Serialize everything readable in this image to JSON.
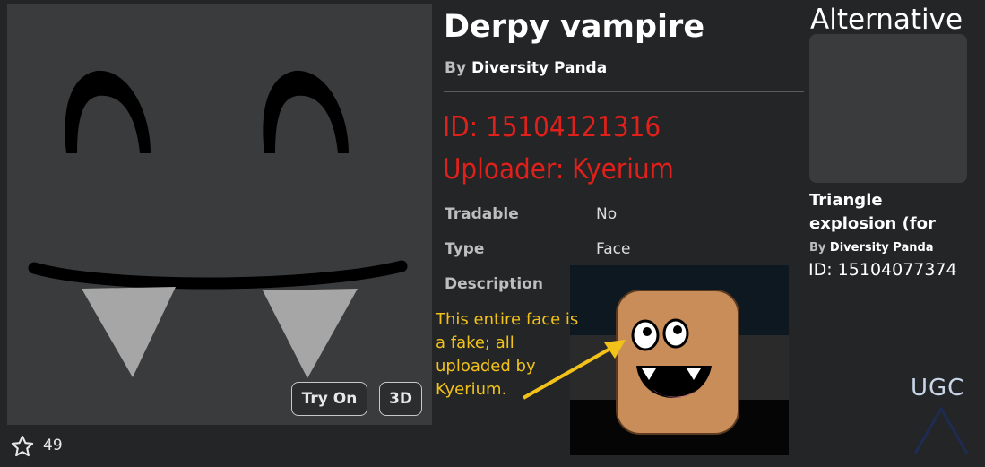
{
  "item": {
    "title": "Derpy vampire",
    "by_prefix": "By",
    "creator": "Diversity Panda",
    "details": [
      {
        "label": "Tradable",
        "value": "No"
      },
      {
        "label": "Type",
        "value": "Face"
      },
      {
        "label": "Description",
        "value": ""
      }
    ]
  },
  "thumbnail": {
    "try_on_label": "Try On",
    "three_d_label": "3D"
  },
  "favorites": {
    "icon": "star-icon",
    "count": "49"
  },
  "overlay": {
    "id_text": "ID: 15104121316",
    "uploader_text": "Uploader: Kyerium",
    "note": "This entire face is a fake; all uploaded by Kyerium.",
    "note_color": "#f2c21a",
    "text_color": "#e0201a"
  },
  "alternative": {
    "heading": "Alternative",
    "name": "Triangle explosion (for",
    "by_prefix": "By",
    "creator": "Diversity Panda",
    "id_text": "ID: 15104077374"
  },
  "watermark": {
    "text": "UGC"
  }
}
